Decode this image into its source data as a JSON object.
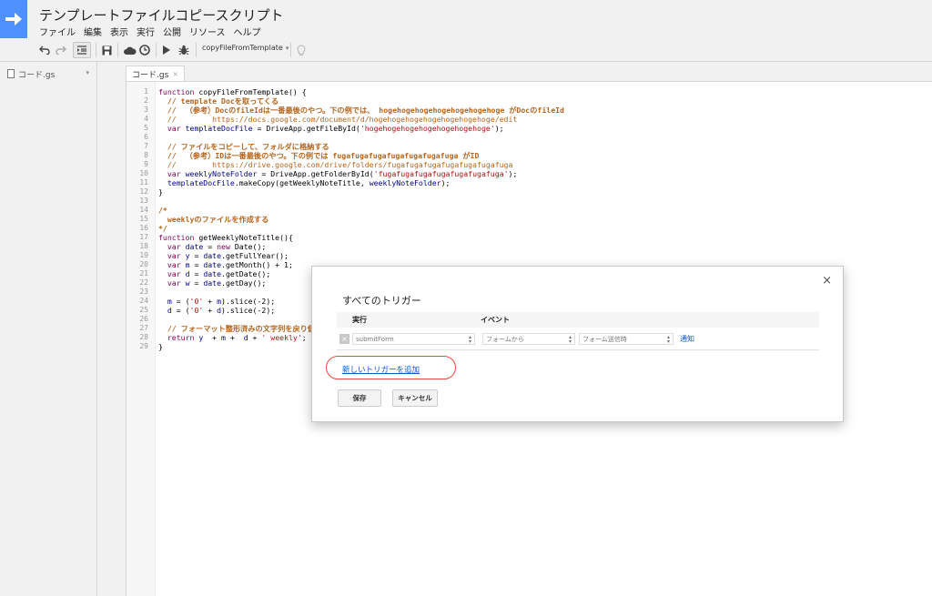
{
  "app": {
    "title": "テンプレートファイルコピースクリプト",
    "menu": [
      "ファイル",
      "編集",
      "表示",
      "実行",
      "公開",
      "リソース",
      "ヘルプ"
    ]
  },
  "toolbar": {
    "function_select": "copyFileFromTemplate",
    "icons": [
      "undo-icon",
      "redo-icon",
      "indent-icon",
      "save-icon",
      "cloud-icon",
      "clock-icon",
      "run-icon",
      "debug-icon",
      "lightbulb-icon"
    ]
  },
  "sidebar": {
    "file_name": "コード.gs"
  },
  "editor": {
    "tab_label": "コード.gs",
    "tab_close": "×",
    "line_numbers": [
      "1",
      "2",
      "3",
      "4",
      "5",
      "6",
      "7",
      "8",
      "9",
      "10",
      "11",
      "12",
      "13",
      "14",
      "15",
      "16",
      "17",
      "18",
      "19",
      "20",
      "21",
      "22",
      "23",
      "24",
      "25",
      "26",
      "27",
      "28",
      "29"
    ],
    "code_lines": [
      "function copyFileFromTemplate() {",
      "  // template Docを取ってくる",
      "  //  （参考）DocのfileIdは一番最後のやつ。下の例では、 hogehogehogehogehogehogehoge がDocのfileId",
      "  //        https://docs.google.com/document/d/hogehogehogehogehogehogehoge/edit",
      "  var templateDocFile = DriveApp.getFileById('hogehogehogehogehogehogehoge');",
      "",
      "  // ファイルをコピーして、フォルダに格納する",
      "  //  （参考）IDは一番最後のやつ。下の例では fugafugafugafugafugafugafuga がID",
      "  //        https://drive.google.com/drive/folders/fugafugafugafugafugafugafuga",
      "  var weeklyNoteFolder = DriveApp.getFolderById('fugafugafugafugafugafugafuga');",
      "  templateDocFile.makeCopy(getWeeklyNoteTitle, weeklyNoteFolder);",
      "}",
      "",
      "/*",
      "  weeklyのファイルを作成する",
      "*/",
      "function getWeeklyNoteTitle(){",
      "  var date = new Date();",
      "  var y = date.getFullYear();",
      "  var m = date.getMonth() + 1;",
      "  var d = date.getDate();",
      "  var w = date.getDay();",
      "",
      "  m = ('0' + m).slice(-2);",
      "  d = ('0' + d).slice(-2);",
      "",
      "  // フォーマット整形済みの文字列を戻り値にす",
      "  return y  + m +  d + ' weekly';",
      "}"
    ]
  },
  "dialog": {
    "close": "×",
    "title": "すべてのトリガー",
    "col_run": "実行",
    "col_event": "イベント",
    "row": {
      "delete": "×",
      "function": "submitForm",
      "source": "フォームから",
      "event_type": "フォーム送信時",
      "notify": "通知"
    },
    "add_trigger": "新しいトリガーを追加",
    "save": "保存",
    "cancel": "キャンセル"
  },
  "colors": {
    "accent": "#4d90fe",
    "link": "#1155cc",
    "highlight": "#e74c3c"
  }
}
